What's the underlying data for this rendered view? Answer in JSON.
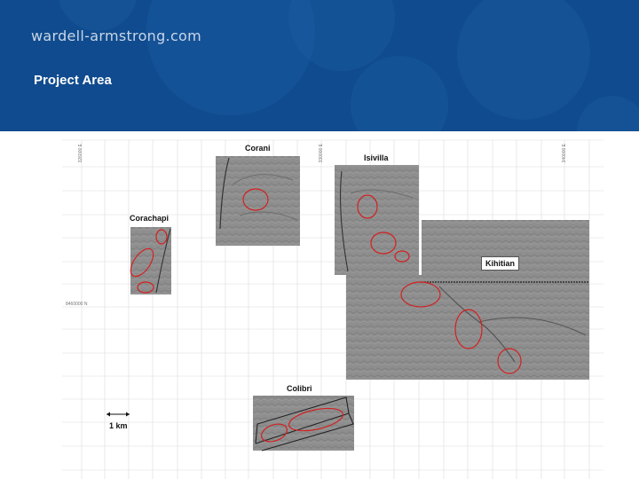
{
  "header": {
    "brand": "wardell-armstrong.com",
    "title": "Project Area",
    "colors": {
      "background": "#0f4b8e",
      "shape": "#1a5a9e"
    }
  },
  "map": {
    "blocks": {
      "corani": {
        "label": "Corani"
      },
      "isivilla": {
        "label": "Isivilla"
      },
      "corachapi": {
        "label": "Corachapi"
      },
      "kihitian": {
        "label": "Kihitian"
      },
      "colibri": {
        "label": "Colibri"
      }
    },
    "scale": {
      "label": "1 km"
    },
    "coords": {
      "easting_1": "326000 E",
      "easting_2": "330000 E",
      "easting_3": "340000 E",
      "northing": "8460000 N"
    },
    "colors": {
      "ellipse": "#d32020",
      "grid": "#d9d9d9",
      "terrain": "#8c8c8c"
    }
  }
}
